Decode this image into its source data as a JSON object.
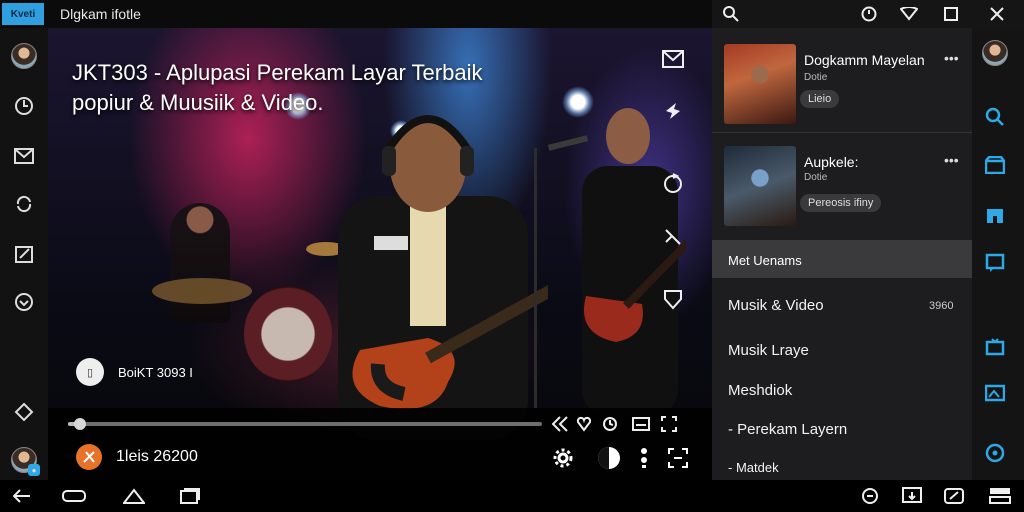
{
  "app": {
    "logo_text": "Kveti",
    "title": "Dlgkam ifotle"
  },
  "left_rail": {
    "icons": [
      "avatar",
      "refresh-icon",
      "mail-icon",
      "sync-icon",
      "edit-icon",
      "favorite-icon",
      "diamond-icon",
      "avatar-user"
    ]
  },
  "video": {
    "title": "JKT303 - Aplupasi Perekam Layar Terbaik popiur & Muusiik & Video.",
    "channel_badge": "BoiKT 3093 I",
    "time": "1leis 26200"
  },
  "panel": {
    "cards": [
      {
        "title": "Dogkamm Mayelan",
        "subtitle": "Dotie",
        "pill": "Lieio"
      },
      {
        "title": "Aupkele:",
        "subtitle": "Dotie",
        "pill": "Pereosis ifiny"
      }
    ],
    "menu_header": "Met Uenams",
    "menu_items": [
      "Musik & Video",
      "Musik Lraye",
      "Meshdiok",
      "- Perekam Layern",
      "- Matdek"
    ],
    "menu_count": "3960"
  },
  "colors": {
    "accent": "#2ea8e6",
    "orange": "#e8722a",
    "panel_bg": "#1d1d1f"
  }
}
